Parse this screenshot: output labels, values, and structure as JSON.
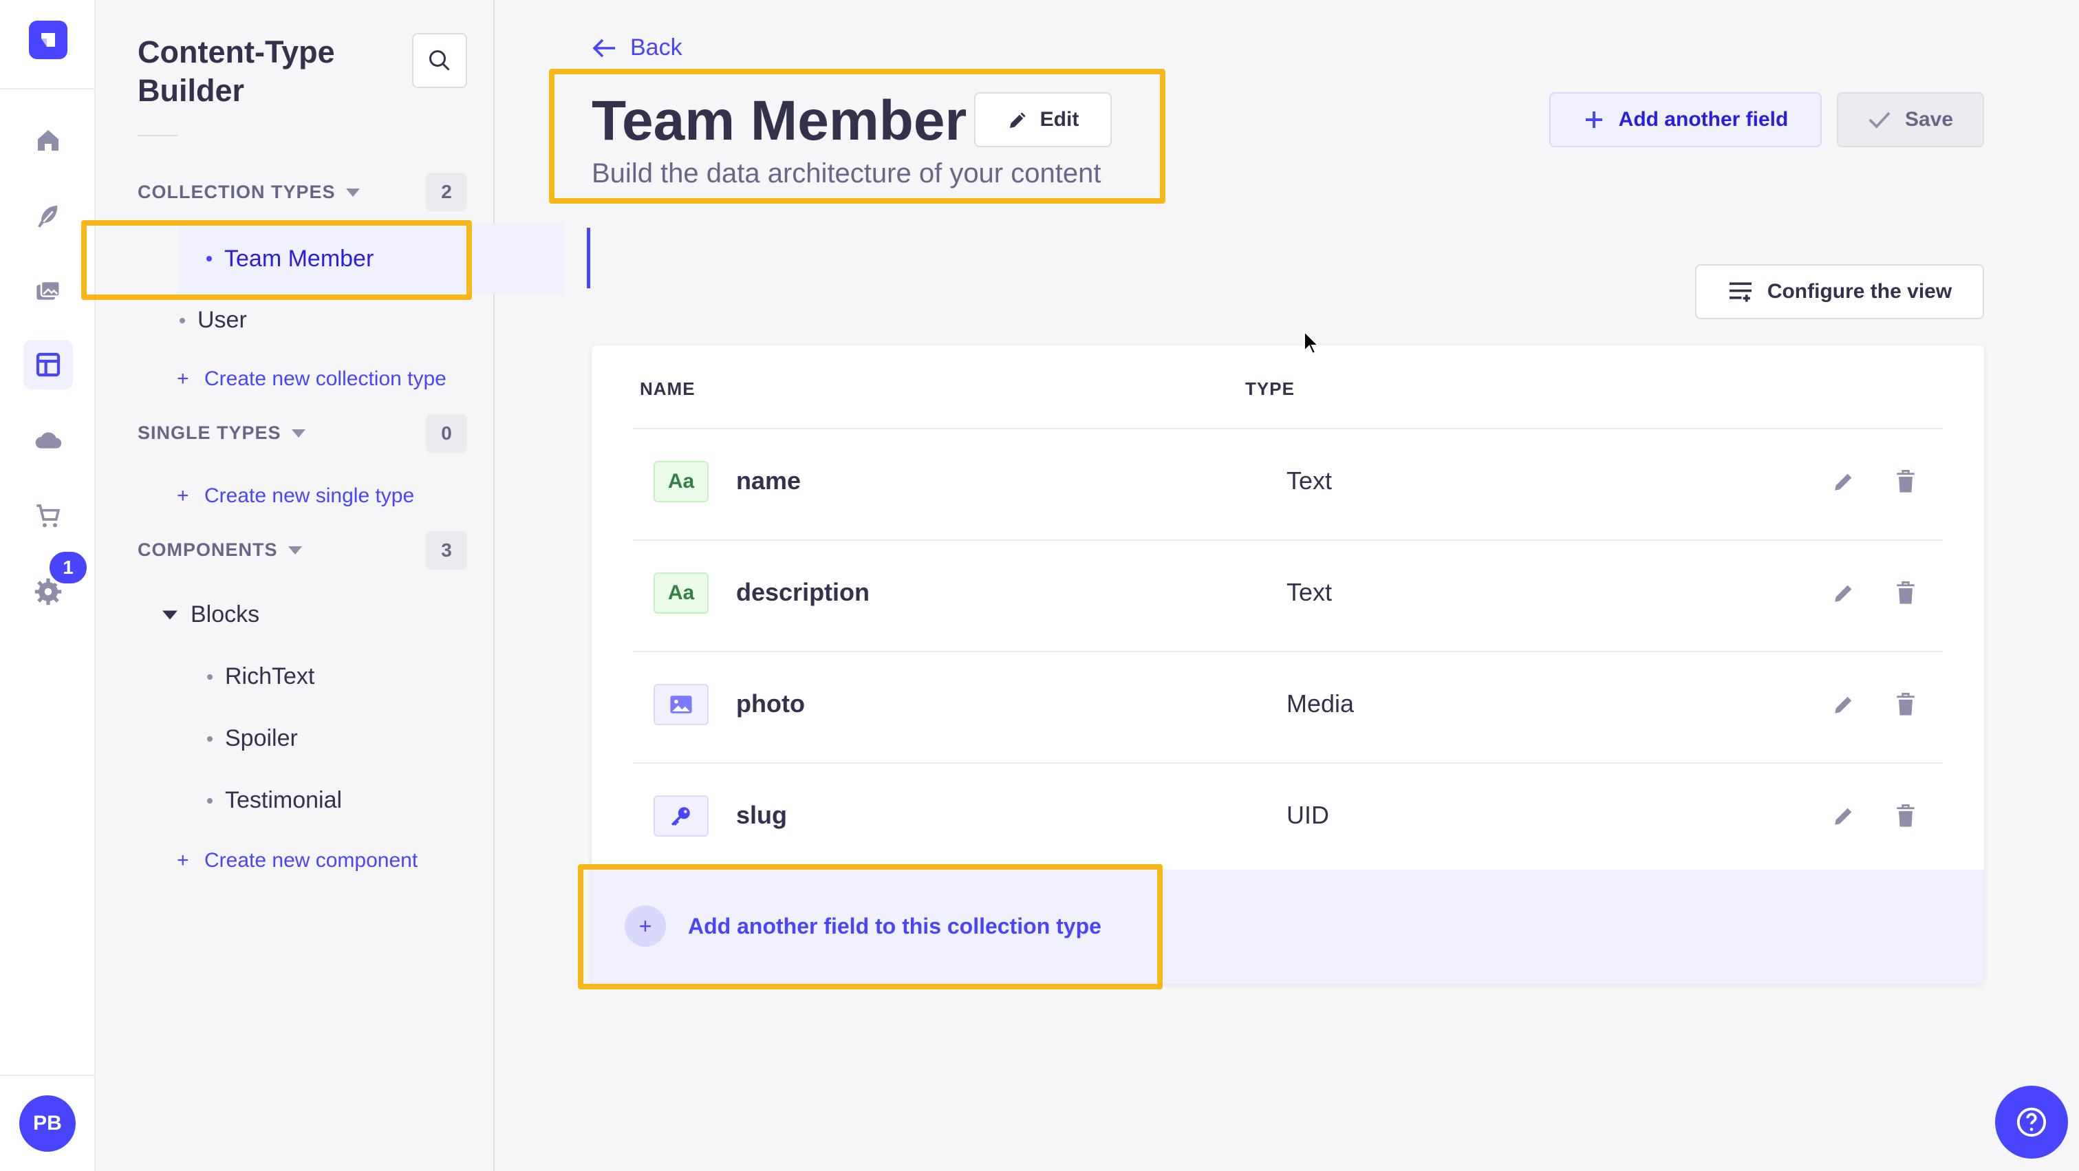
{
  "rail": {
    "badge": "1",
    "avatar_initials": "PB",
    "icons": [
      "home-icon",
      "feather-icon",
      "media-library-icon",
      "content-type-builder-icon",
      "cloud-icon",
      "cart-icon",
      "settings-icon"
    ]
  },
  "subnav": {
    "title": "Content-Type Builder",
    "collection_types": {
      "heading": "COLLECTION TYPES",
      "count": "2",
      "items": [
        {
          "label": "Team Member",
          "active": true
        },
        {
          "label": "User",
          "active": false
        }
      ],
      "create_label": "Create new collection type"
    },
    "single_types": {
      "heading": "SINGLE TYPES",
      "count": "0",
      "create_label": "Create new single type"
    },
    "components": {
      "heading": "COMPONENTS",
      "count": "3",
      "group": "Blocks",
      "items": [
        {
          "label": "RichText"
        },
        {
          "label": "Spoiler"
        },
        {
          "label": "Testimonial"
        }
      ],
      "create_label": "Create new component"
    }
  },
  "header": {
    "back_label": "Back",
    "title": "Team Member",
    "edit_label": "Edit",
    "subtitle": "Build the data architecture of your content",
    "add_field_label": "Add another field",
    "save_label": "Save",
    "configure_label": "Configure the view"
  },
  "table": {
    "columns": {
      "name": "NAME",
      "type": "TYPE"
    },
    "rows": [
      {
        "name": "name",
        "type": "Text",
        "icon": "text-icon",
        "icon_text": "Aa"
      },
      {
        "name": "description",
        "type": "Text",
        "icon": "text-icon",
        "icon_text": "Aa"
      },
      {
        "name": "photo",
        "type": "Media",
        "icon": "media-icon"
      },
      {
        "name": "slug",
        "type": "UID",
        "icon": "key-icon"
      }
    ],
    "add_footer_label": "Add another field to this collection type"
  },
  "colors": {
    "primary": "#4945ff",
    "highlight": "#f6b818",
    "text": "#32324d",
    "muted": "#666687"
  }
}
